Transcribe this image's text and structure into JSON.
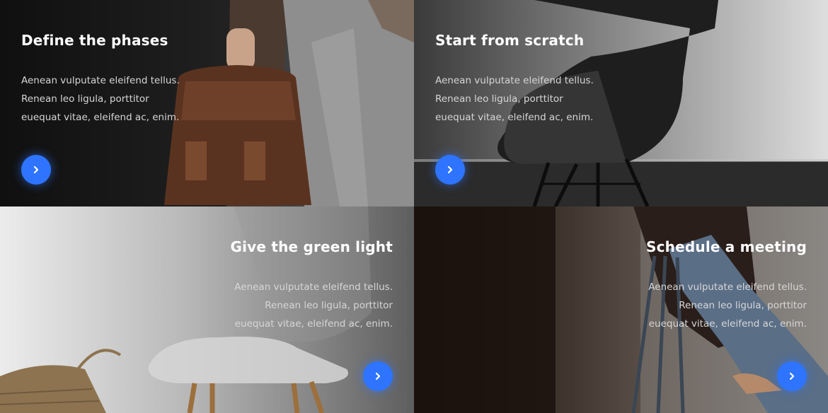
{
  "cards": [
    {
      "title": "Define the phases",
      "lines": [
        "Aenean vulputate eleifend tellus.",
        "Renean leo ligula, porttitor",
        "euequat vitae, eleifend ac, enim."
      ],
      "button_icon": "chevron-right-icon",
      "image": "person-with-leather-backpack-photo"
    },
    {
      "title": "Start from scratch",
      "lines": [
        "Aenean vulputate eleifend tellus.",
        "Renean leo ligula, porttitor",
        "euequat vitae, eleifend ac, enim."
      ],
      "button_icon": "chevron-right-icon",
      "image": "black-shell-chair-photo"
    },
    {
      "title": "Give the green light",
      "lines": [
        "Aenean vulputate eleifend tellus.",
        "Renean leo ligula, porttitor",
        "euequat vitae, eleifend ac, enim."
      ],
      "button_icon": "chevron-right-icon",
      "image": "white-chair-and-basket-photo"
    },
    {
      "title": "Schedule a meeting",
      "lines": [
        "Aenean vulputate eleifend tellus.",
        "Renean leo ligula, porttitor",
        "euequat vitae, eleifend ac, enim."
      ],
      "button_icon": "chevron-right-icon",
      "image": "person-with-stool-photo"
    }
  ],
  "colors": {
    "accent": "#2e74ff",
    "title": "#ffffff",
    "text": "#d6d6d6"
  }
}
